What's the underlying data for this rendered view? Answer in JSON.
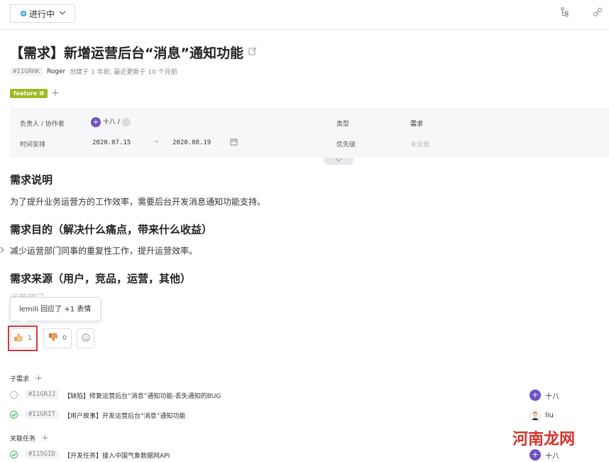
{
  "toolbar": {
    "status_label": "进行中"
  },
  "issue": {
    "title": "【需求】新增运营后台“消息”通知功能",
    "id": "#I1GRHK",
    "author": "Roger",
    "meta_text": "创建于 1 年前, 最近更新于 10 个月前",
    "tag": "feature ⌘"
  },
  "fields": {
    "owner_label": "负责人 / 协作者",
    "owner_value": "十八 /",
    "schedule_label": "时间安排",
    "start_date": "2020.07.15",
    "arrow": "→",
    "end_date": "2020.08.19",
    "type_label": "类型",
    "type_value": "需求",
    "priority_label": "优先级",
    "priority_value": "未设置"
  },
  "content": {
    "h1": "需求说明",
    "p1": "为了提升业务运营方的工作效率，需要后台开发消息通知功能支持。",
    "h2": "需求目的（解决什么痛点，带来什么收益）",
    "p2": "减少运营部门同事的重复性工作，提升运营效率。",
    "h3": "需求来源（用户，竞品，运营，其他）",
    "p3_clipped": "运营部门"
  },
  "reactions": {
    "tooltip": "lemili 回应了 +1 表情",
    "thumbs_up_count": "1",
    "thumbs_down_count": "0"
  },
  "subtasks": {
    "label": "子需求",
    "items": [
      {
        "id": "#I1GRJJ",
        "title": "【缺陷】修复运营后台“消息”通知功能-丢失通知的BUG",
        "assignee": "十八",
        "status": "open"
      },
      {
        "id": "#I1GRIT",
        "title": "【用户故事】开发运营后台“消息”通知功能",
        "assignee": "liu",
        "status": "done"
      }
    ]
  },
  "related": {
    "label": "关联任务",
    "items": [
      {
        "id": "#I15GID",
        "title": "【开发任务】接入中国气象数据网API",
        "assignee": "十八",
        "status": "done"
      }
    ]
  },
  "watermark": "河南龙网",
  "colors": {
    "accent_blue": "#2aa0d8",
    "tag_green": "#9dbb22",
    "avatar_purple": "#6f52bd",
    "done_green": "#3bb35a",
    "highlight_red": "#d9363e"
  }
}
